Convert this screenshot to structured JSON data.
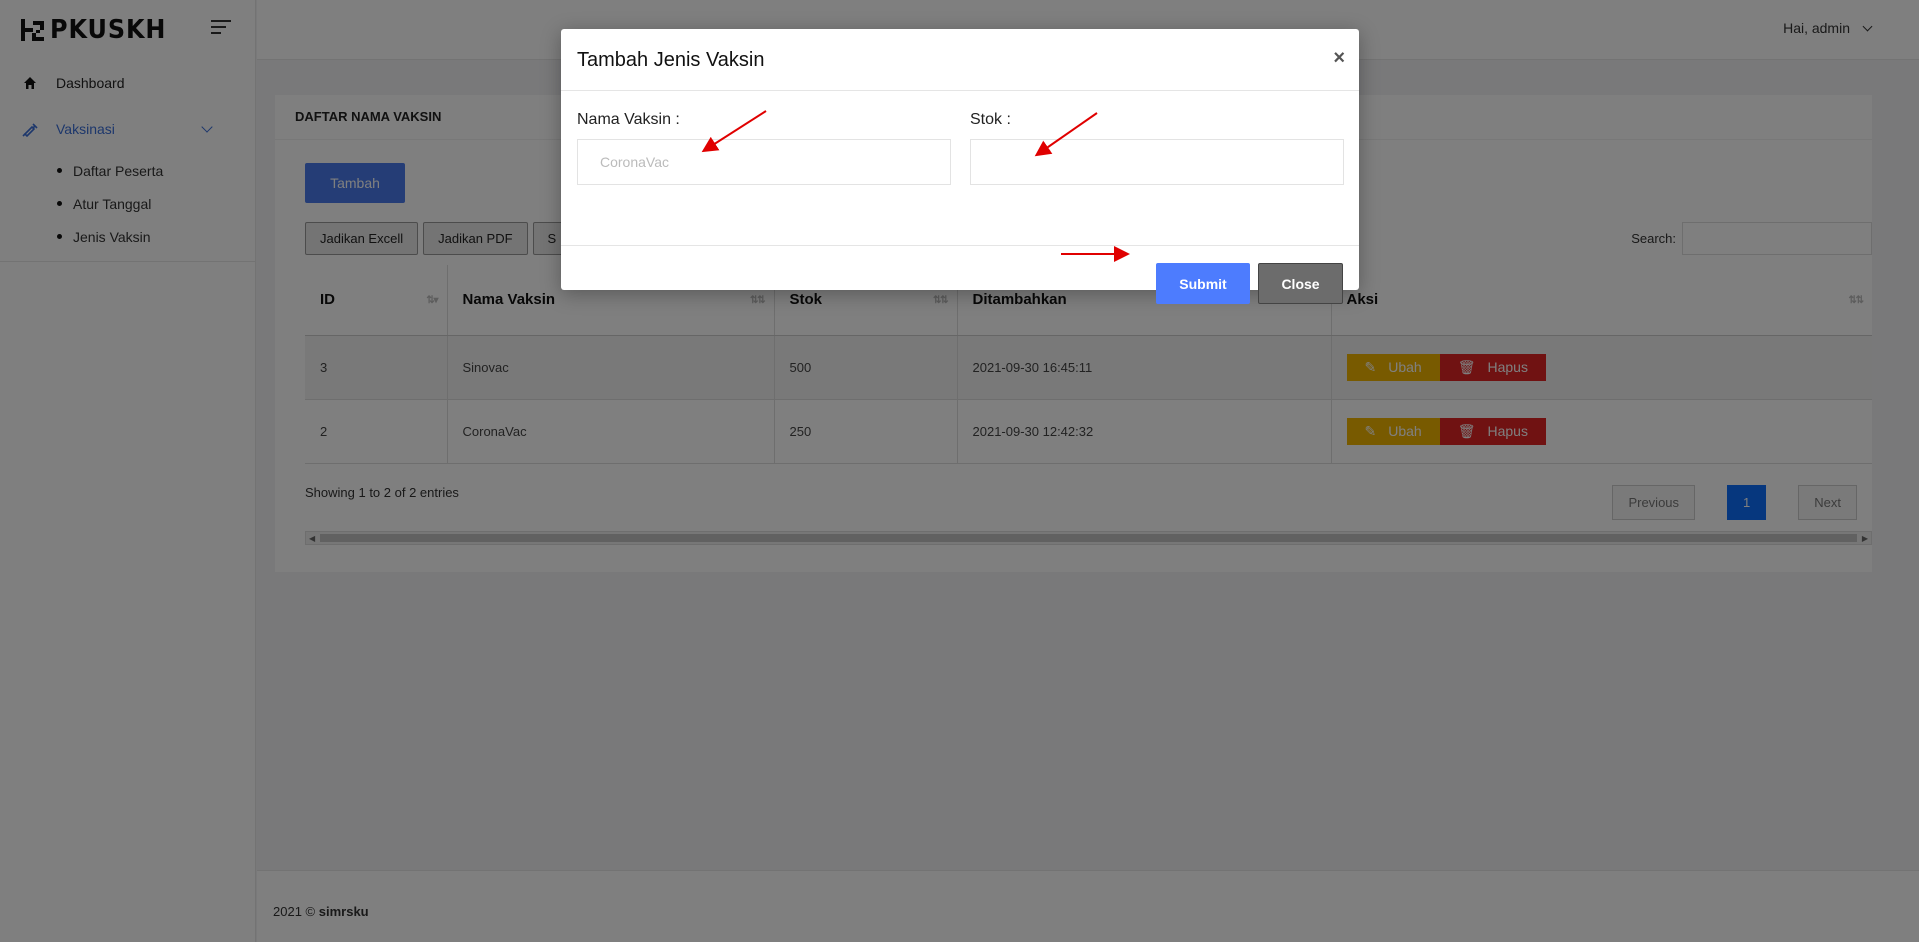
{
  "brand": {
    "logo_text": "PKUSKH"
  },
  "topbar": {
    "user_label": "Hai, admin"
  },
  "sidebar": {
    "items": [
      {
        "label": "Dashboard",
        "icon": "home-icon"
      },
      {
        "label": "Vaksinasi",
        "icon": "syringe-icon",
        "active": true
      }
    ],
    "submenu": [
      "Daftar Peserta",
      "Atur Tanggal",
      "Jenis Vaksin"
    ]
  },
  "card": {
    "title": "DAFTAR NAMA VAKSIN",
    "add_button": "Tambah",
    "export_buttons": [
      "Jadikan Excell",
      "Jadikan PDF",
      "S"
    ],
    "search_label": "Search:"
  },
  "table": {
    "columns": [
      "ID",
      "Nama Vaksin",
      "Stok",
      "Ditambahkan",
      "Aksi"
    ],
    "rows": [
      {
        "id": "3",
        "nama": "Sinovac",
        "stok": "500",
        "ditambahkan": "2021-09-30 16:45:11"
      },
      {
        "id": "2",
        "nama": "CoronaVac",
        "stok": "250",
        "ditambahkan": "2021-09-30 12:42:32"
      }
    ],
    "edit_label": "Ubah",
    "delete_label": "Hapus"
  },
  "pagination": {
    "info": "Showing 1 to 2 of 2 entries",
    "previous": "Previous",
    "current": "1",
    "next": "Next"
  },
  "footer": {
    "year": "2021 ©",
    "brand": "simrsku"
  },
  "modal": {
    "title": "Tambah Jenis Vaksin",
    "close_symbol": "×",
    "nama_label": "Nama Vaksin :",
    "nama_placeholder": "CoronaVac",
    "stok_label": "Stok :",
    "stok_placeholder": "",
    "submit": "Submit",
    "close": "Close"
  },
  "colors": {
    "primary": "#4d7cfe",
    "warning": "#f0b400",
    "danger": "#e02424",
    "annotation_arrow": "#e00000"
  }
}
